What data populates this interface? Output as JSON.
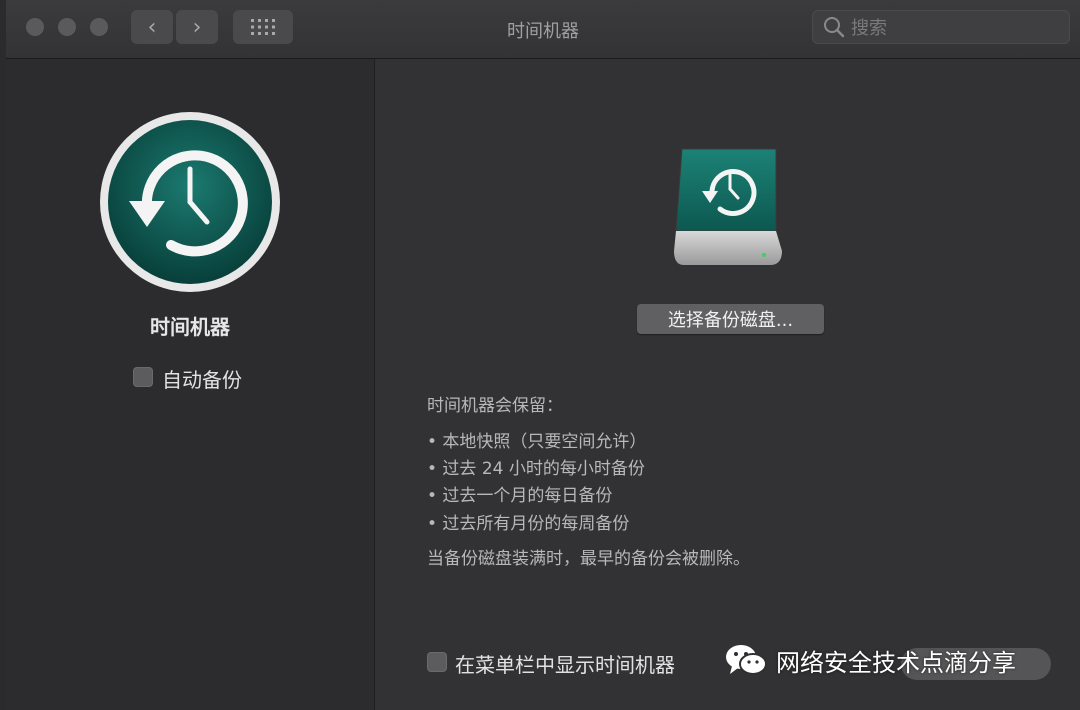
{
  "window": {
    "title": "时间机器",
    "back_glyph": "‹",
    "forward_glyph": "›",
    "search_placeholder": "搜索"
  },
  "sidebar": {
    "app_name": "时间机器",
    "auto_backup_label": "自动备份",
    "auto_backup_checked": false
  },
  "main": {
    "select_disk_button": "选择备份磁盘...",
    "keeps_heading": "时间机器会保留：",
    "keeps_items": [
      "• 本地快照（只要空间允许）",
      "• 过去 24 小时的每小时备份",
      "• 过去一个月的每日备份",
      "• 过去所有月份的每周备份"
    ],
    "delete_note": "当备份磁盘装满时，最早的备份会被删除。",
    "menubar_label": "在菜单栏中显示时间机器",
    "menubar_checked": false
  },
  "watermark": {
    "text": "网络安全技术点滴分享"
  },
  "colors": {
    "accent_teal": "#0d5e56",
    "ring_white": "#f2f2f2",
    "background": "#2f2f31"
  }
}
